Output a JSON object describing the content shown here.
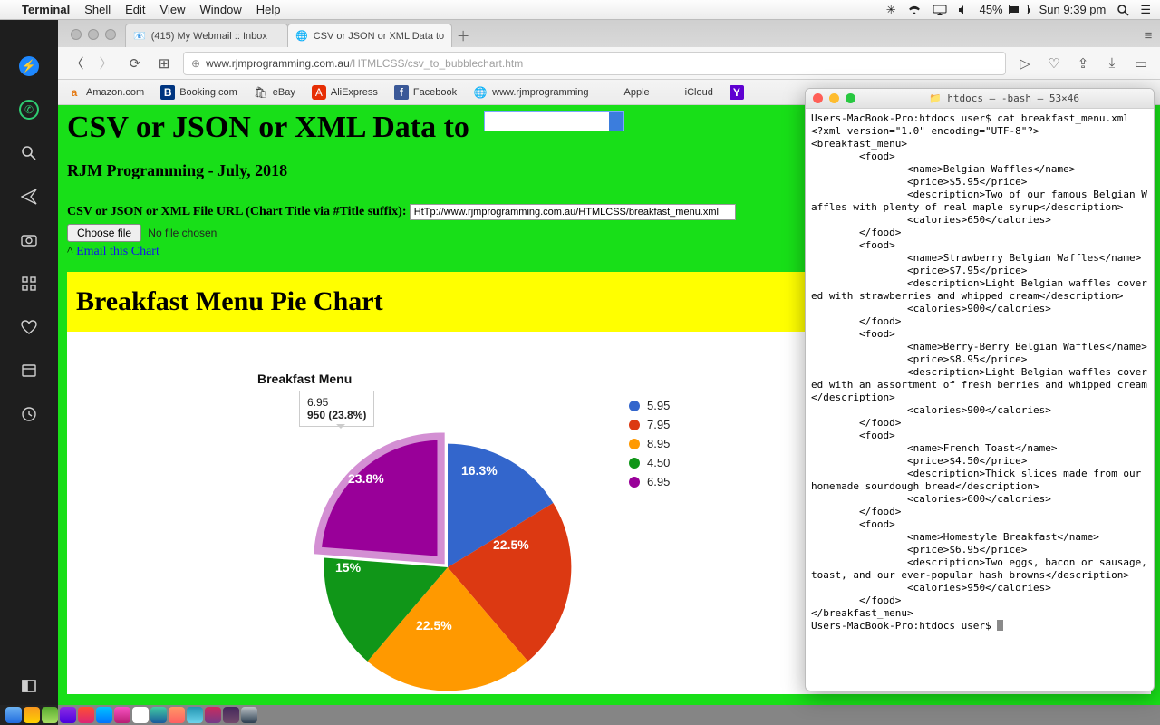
{
  "menubar": {
    "app": "Terminal",
    "items": [
      "Shell",
      "Edit",
      "View",
      "Window",
      "Help"
    ],
    "battery_pct": "45%",
    "clock": "Sun 9:39 pm"
  },
  "tabs": [
    {
      "label": "(415) My Webmail :: Inbox"
    },
    {
      "label": "CSV or JSON or XML Data to"
    }
  ],
  "url": {
    "host": "www.rjmprogramming.com.au",
    "path": "/HTMLCSS/csv_to_bubblechart.htm"
  },
  "bookmarks": [
    "Amazon.com",
    "Booking.com",
    "eBay",
    "AliExpress",
    "Facebook",
    "www.rjmprogramming",
    "Apple",
    "iCloud"
  ],
  "page": {
    "h1": "CSV or JSON or XML Data to ",
    "sub": "RJM Programming - July, 2018",
    "file_label": "CSV or JSON or XML File URL (Chart Title via #Title suffix):",
    "file_url": "HtTp://www.rjmprogramming.com.au/HTMLCSS/breakfast_menu.xml",
    "choose": "Choose file",
    "nofile": "No file chosen",
    "email_prefix": "^ ",
    "email": "Email this Chart",
    "chart_h": "Breakfast Menu Pie Chart",
    "chart_title": "Breakfast Menu",
    "tooltip_l1": "6.95",
    "tooltip_l2": "950 (23.8%)"
  },
  "legend": [
    {
      "c": "#3366cc",
      "t": "5.95"
    },
    {
      "c": "#dc3912",
      "t": "7.95"
    },
    {
      "c": "#ff9900",
      "t": "8.95"
    },
    {
      "c": "#109618",
      "t": "4.50"
    },
    {
      "c": "#990099",
      "t": "6.95"
    }
  ],
  "chart_data": {
    "type": "pie",
    "title": "Breakfast Menu",
    "series": [
      {
        "name": "5.95",
        "value": 650,
        "pct": 16.3,
        "color": "#3366cc"
      },
      {
        "name": "7.95",
        "value": 900,
        "pct": 22.5,
        "color": "#dc3912"
      },
      {
        "name": "8.95",
        "value": 900,
        "pct": 22.5,
        "color": "#ff9900"
      },
      {
        "name": "4.50",
        "value": 600,
        "pct": 15.0,
        "color": "#109618"
      },
      {
        "name": "6.95",
        "value": 950,
        "pct": 23.8,
        "color": "#990099"
      }
    ],
    "selected_index": 4,
    "tooltip": {
      "name": "6.95",
      "value": 950,
      "pct": 23.8
    }
  },
  "terminal": {
    "title": "htdocs — -bash — 53×46",
    "body": "Users-MacBook-Pro:htdocs user$ cat breakfast_menu.xml\n<?xml version=\"1.0\" encoding=\"UTF-8\"?>\n<breakfast_menu>\n        <food>\n                <name>Belgian Waffles</name>\n                <price>$5.95</price>\n                <description>Two of our famous Belgian Waffles with plenty of real maple syrup</description>\n                <calories>650</calories>\n        </food>\n        <food>\n                <name>Strawberry Belgian Waffles</name>\n                <price>$7.95</price>\n                <description>Light Belgian waffles covered with strawberries and whipped cream</description>\n                <calories>900</calories>\n        </food>\n        <food>\n                <name>Berry-Berry Belgian Waffles</name>\n                <price>$8.95</price>\n                <description>Light Belgian waffles covered with an assortment of fresh berries and whipped cream</description>\n                <calories>900</calories>\n        </food>\n        <food>\n                <name>French Toast</name>\n                <price>$4.50</price>\n                <description>Thick slices made from our homemade sourdough bread</description>\n                <calories>600</calories>\n        </food>\n        <food>\n                <name>Homestyle Breakfast</name>\n                <price>$6.95</price>\n                <description>Two eggs, bacon or sausage, toast, and our ever-popular hash browns</description>\n                <calories>950</calories>\n        </food>\n</breakfast_menu>\nUsers-MacBook-Pro:htdocs user$ "
  }
}
